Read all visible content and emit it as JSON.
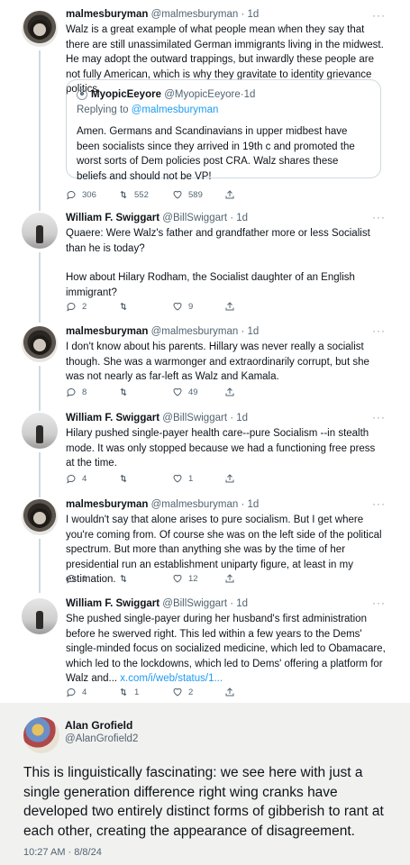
{
  "tweets": [
    {
      "name": "malmesburyman",
      "handle": "@malmesburyman",
      "time": "1d",
      "text": "Walz is a great example of what people mean when they say that there are still unassimilated German immigrants living in the midwest. He may adopt the outward trappings, but inwardly these people are not fully American, which is why they gravitate to identity grievance politics.",
      "quote": {
        "name": "MyopicEeyore",
        "handle": "@MyopicEeyore",
        "time": "1d",
        "replying_prefix": "Replying to ",
        "replying_to": "@malmesburyman",
        "text": "Amen. Germans and Scandinavians in upper midbest have been socialists since they arrived in 19th c and promoted the worst sorts of Dem policies post CRA. Walz shares these beliefs and should not be VP!"
      },
      "replies": "306",
      "retweets": "552",
      "likes": "589"
    },
    {
      "name": "William F. Swiggart",
      "handle": "@BillSwiggart",
      "time": "1d",
      "text_p1": "Quaere: Were Walz's father and grandfather more or less Socialist than he is today?",
      "text_p2": "How about Hilary Rodham, the Socialist daughter of an English immigrant?",
      "replies": "2",
      "retweets": "",
      "likes": "9"
    },
    {
      "name": "malmesburyman",
      "handle": "@malmesburyman",
      "time": "1d",
      "text": "I don't know about his parents. Hillary was never really a socialist though. She was a warmonger and extraordinarily corrupt, but she was not nearly as far-left as Walz and Kamala.",
      "replies": "8",
      "retweets": "",
      "likes": "49"
    },
    {
      "name": "William F. Swiggart",
      "handle": "@BillSwiggart",
      "time": "1d",
      "text": "Hilary pushed single-payer health care--pure Socialism --in stealth mode. It was only stopped because we had a functioning free press at the time.",
      "replies": "4",
      "retweets": "",
      "likes": "1"
    },
    {
      "name": "malmesburyman",
      "handle": "@malmesburyman",
      "time": "1d",
      "text": "I wouldn't say that alone arises to pure socialism. But I get where you're coming from. Of course she was on the left side of the political spectrum. But more than anything she was by the time of her presidential run an establishment uniparty figure, at least in my estimation.",
      "replies": "1",
      "retweets": "",
      "likes": "12"
    },
    {
      "name": "William F. Swiggart",
      "handle": "@BillSwiggart",
      "time": "1d",
      "text": "She pushed single-payer during her husband's first administration before he swerved right. This led within a few years to the Dems' single-minded focus on socialized medicine, which led to Obamacare, which led to the lockdowns, which led to Dems' offering a platform for Walz and... ",
      "link": "x.com/i/web/status/1...",
      "replies": "4",
      "retweets": "1",
      "likes": "2"
    }
  ],
  "main_post": {
    "name": "Alan Grofield",
    "handle": "@AlanGrofield2",
    "text": "This is linguistically fascinating: we see here with just a single generation difference right wing cranks have developed two entirely distinct forms of gibberish to rant at each other, creating the appearance of disagreement.",
    "timestamp": "10:27 AM · 8/8/24"
  },
  "ui": {
    "separator": " · ",
    "more_label": "···"
  },
  "colors": {
    "link": "#1d9bf0",
    "secondary_text": "#536471",
    "thread_line": "#cfd9de",
    "main_background": "#f1f1f0"
  }
}
